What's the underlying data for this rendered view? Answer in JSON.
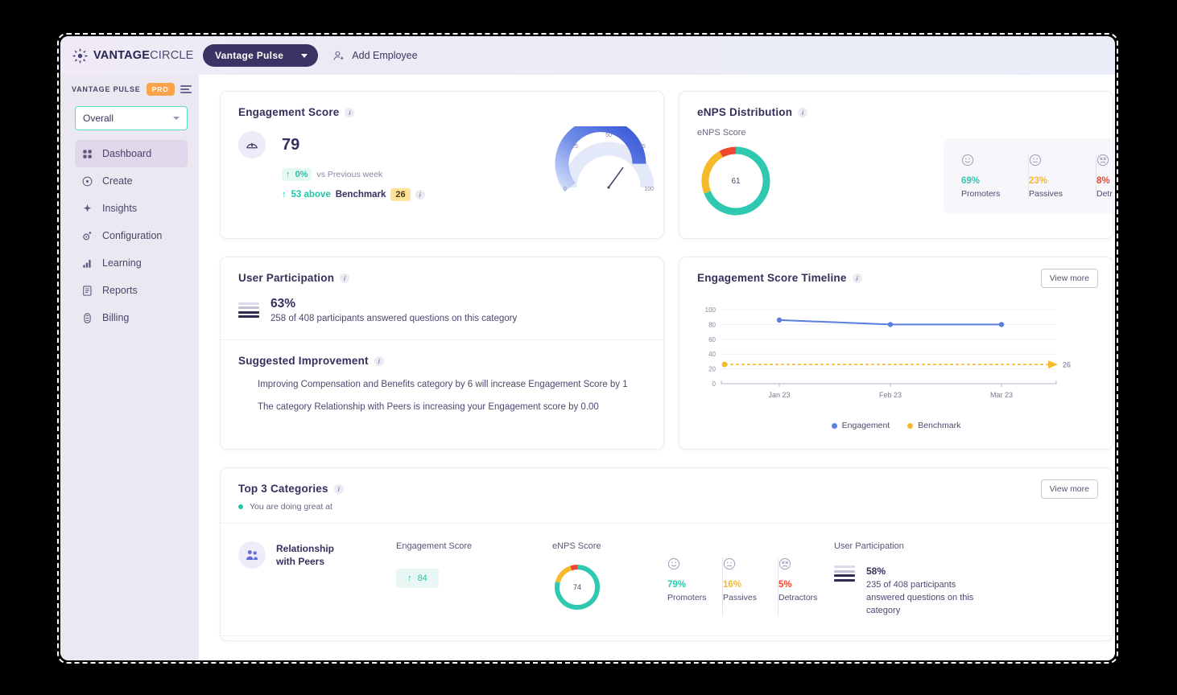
{
  "brand": {
    "logo_icon": "vantage-starburst-logo",
    "name_bold": "VANTAGE",
    "name_light": "CIRCLE"
  },
  "topbar": {
    "product_pill": "Vantage Pulse",
    "pill_caret_icon": "chevron-down-icon",
    "add_employee_label": "Add Employee",
    "add_employee_icon": "add-user-icon"
  },
  "sidebar": {
    "product_label": "VANTAGE PULSE",
    "plan_badge": "PRO",
    "menu_icon": "hamburger-icon",
    "filter_value": "Overall",
    "filter_caret_icon": "chevron-down-icon",
    "items": [
      {
        "label": "Dashboard",
        "icon": "grid-icon",
        "active": true
      },
      {
        "label": "Create",
        "icon": "plus-circle-icon",
        "active": false
      },
      {
        "label": "Insights",
        "icon": "sparkle-icon",
        "active": false
      },
      {
        "label": "Configuration",
        "icon": "gear-icon",
        "active": false
      },
      {
        "label": "Learning",
        "icon": "bar-chart-icon",
        "active": false
      },
      {
        "label": "Reports",
        "icon": "document-icon",
        "active": false
      },
      {
        "label": "Billing",
        "icon": "billing-icon",
        "active": false
      }
    ]
  },
  "engagement_card": {
    "title": "Engagement Score",
    "icon": "speedometer-icon",
    "score": "79",
    "change_pct": "0%",
    "change_caption": "vs Previous week",
    "benchmark_delta": "53 above",
    "benchmark_label": "Benchmark",
    "benchmark_value": "26",
    "gauge_ticks": [
      "0",
      "25",
      "50",
      "75",
      "100"
    ]
  },
  "enps_card": {
    "title": "eNPS Distribution",
    "subtitle": "eNPS Score",
    "score": "61",
    "segments": [
      {
        "name": "Promoters",
        "pct": "69%",
        "color": "#2ec9b0",
        "icon": "smiley-happy-icon"
      },
      {
        "name": "Passives",
        "pct": "23%",
        "color": "#f5b92a",
        "icon": "smiley-neutral-icon"
      },
      {
        "name": "Detractors",
        "pct": "8%",
        "color": "#f0452f",
        "icon": "smiley-sad-icon"
      }
    ]
  },
  "participation_card": {
    "title": "User Participation",
    "icon": "bars-icon",
    "pct": "63%",
    "description": "258 of 408 participants answered questions on this category",
    "improvement_title": "Suggested Improvement",
    "suggestions": [
      "Improving Compensation and Benefits category by 6 will increase Engagement Score by 1",
      "The category Relationship with Peers is increasing your Engagement score by 0.00"
    ]
  },
  "timeline_card": {
    "title": "Engagement Score Timeline",
    "view_more_label": "View more",
    "benchmark_end_label": "26"
  },
  "top3_card": {
    "title": "Top 3 Categories",
    "view_more_label": "View more",
    "note": "You are doing great at",
    "col_engagement": "Engagement Score",
    "col_enps": "eNPS Score",
    "col_participation": "User Participation",
    "rows": [
      {
        "category_line1": "Relationship",
        "category_line2": "with Peers",
        "category_icon": "people-group-icon",
        "engagement_score": "84",
        "enps_score": "74",
        "segments": [
          {
            "name": "Promoters",
            "pct": "79%",
            "color": "#2ec9b0",
            "icon": "smiley-happy-icon"
          },
          {
            "name": "Passives",
            "pct": "16%",
            "color": "#f5b92a",
            "icon": "smiley-neutral-icon"
          },
          {
            "name": "Detractors",
            "pct": "5%",
            "color": "#f0452f",
            "icon": "smiley-sad-icon"
          }
        ],
        "participation_pct": "58%",
        "participation_desc": "235 of 408 participants answered questions on this category"
      }
    ]
  },
  "chart_data": [
    {
      "type": "line",
      "name": "Engagement Score Timeline",
      "title": "Engagement Score Timeline",
      "categories": [
        "Jan 23",
        "Feb 23",
        "Mar 23"
      ],
      "series": [
        {
          "name": "Engagement",
          "values": [
            86,
            80,
            80
          ],
          "color": "#5a7fe0"
        },
        {
          "name": "Benchmark",
          "values": [
            26,
            26,
            26
          ],
          "color": "#f5b92a",
          "style": "dashed"
        }
      ],
      "ylabel": "",
      "xlabel": "",
      "ylim": [
        0,
        100
      ],
      "yticks": [
        0,
        20,
        40,
        60,
        80,
        100
      ],
      "grid": true,
      "legend": "bottom-center",
      "annotations": [
        {
          "text": "26",
          "series": "Benchmark",
          "position": "right-end"
        }
      ]
    },
    {
      "type": "gauge",
      "name": "Engagement Score Gauge",
      "value": 79,
      "min": 0,
      "max": 100,
      "ticks": [
        0,
        25,
        50,
        75,
        100
      ],
      "color": "#3b5bdb"
    },
    {
      "type": "pie",
      "name": "eNPS Distribution Donut",
      "center_label": "61",
      "labels": [
        "Promoters",
        "Passives",
        "Detractors"
      ],
      "values": [
        69,
        23,
        8
      ],
      "colors": [
        "#2ec9b0",
        "#f5b92a",
        "#f0452f"
      ]
    },
    {
      "type": "pie",
      "name": "Relationship with Peers eNPS Donut",
      "center_label": "74",
      "labels": [
        "Promoters",
        "Passives",
        "Detractors"
      ],
      "values": [
        79,
        16,
        5
      ],
      "colors": [
        "#2ec9b0",
        "#f5b92a",
        "#f0452f"
      ]
    }
  ]
}
